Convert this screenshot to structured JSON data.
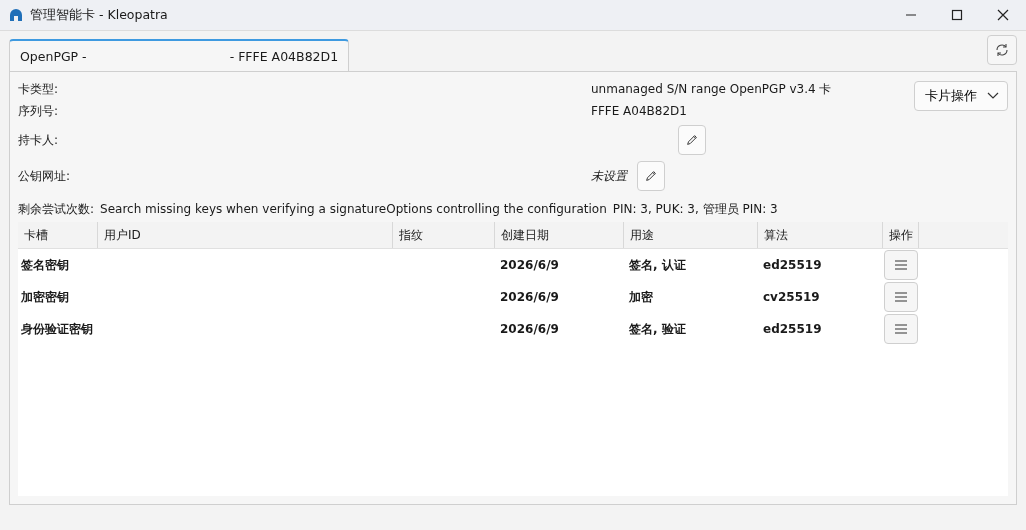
{
  "window": {
    "title": "管理智能卡 - Kleopatra"
  },
  "tabs": [
    {
      "label": "OpenPGP -                                    - FFFE A04B82D1",
      "selected": true
    }
  ],
  "card": {
    "fields": [
      {
        "label": "卡类型:",
        "value": "unmanaged S/N range OpenPGP v3.4 卡",
        "kind": "text"
      },
      {
        "label": "序列号:",
        "value": "FFFE A04B82D1",
        "kind": "text"
      },
      {
        "label": "持卡人:",
        "kind": "edit"
      },
      {
        "label": "公钥网址:",
        "value": "未设置",
        "kind": "edit"
      }
    ],
    "actions_button": "卡片操作",
    "retries": {
      "label": "剩余尝试次数:",
      "text": "Search missing keys when verifying a signatureOptions controlling the configuration",
      "value": "PIN: 3, PUK: 3, 管理员 PIN: 3"
    }
  },
  "table": {
    "columns": [
      "卡槽",
      "用户ID",
      "指纹",
      "创建日期",
      "用途",
      "算法",
      "操作"
    ],
    "rows": [
      {
        "slot": "签名密钥",
        "created": "2026/6/9",
        "usage": "签名, 认证",
        "algorithm": "ed25519"
      },
      {
        "slot": "加密密钥",
        "created": "2026/6/9",
        "usage": "加密",
        "algorithm": "cv25519"
      },
      {
        "slot": "身份验证密钥",
        "created": "2026/6/9",
        "usage": "签名, 验证",
        "algorithm": "ed25519"
      }
    ]
  }
}
